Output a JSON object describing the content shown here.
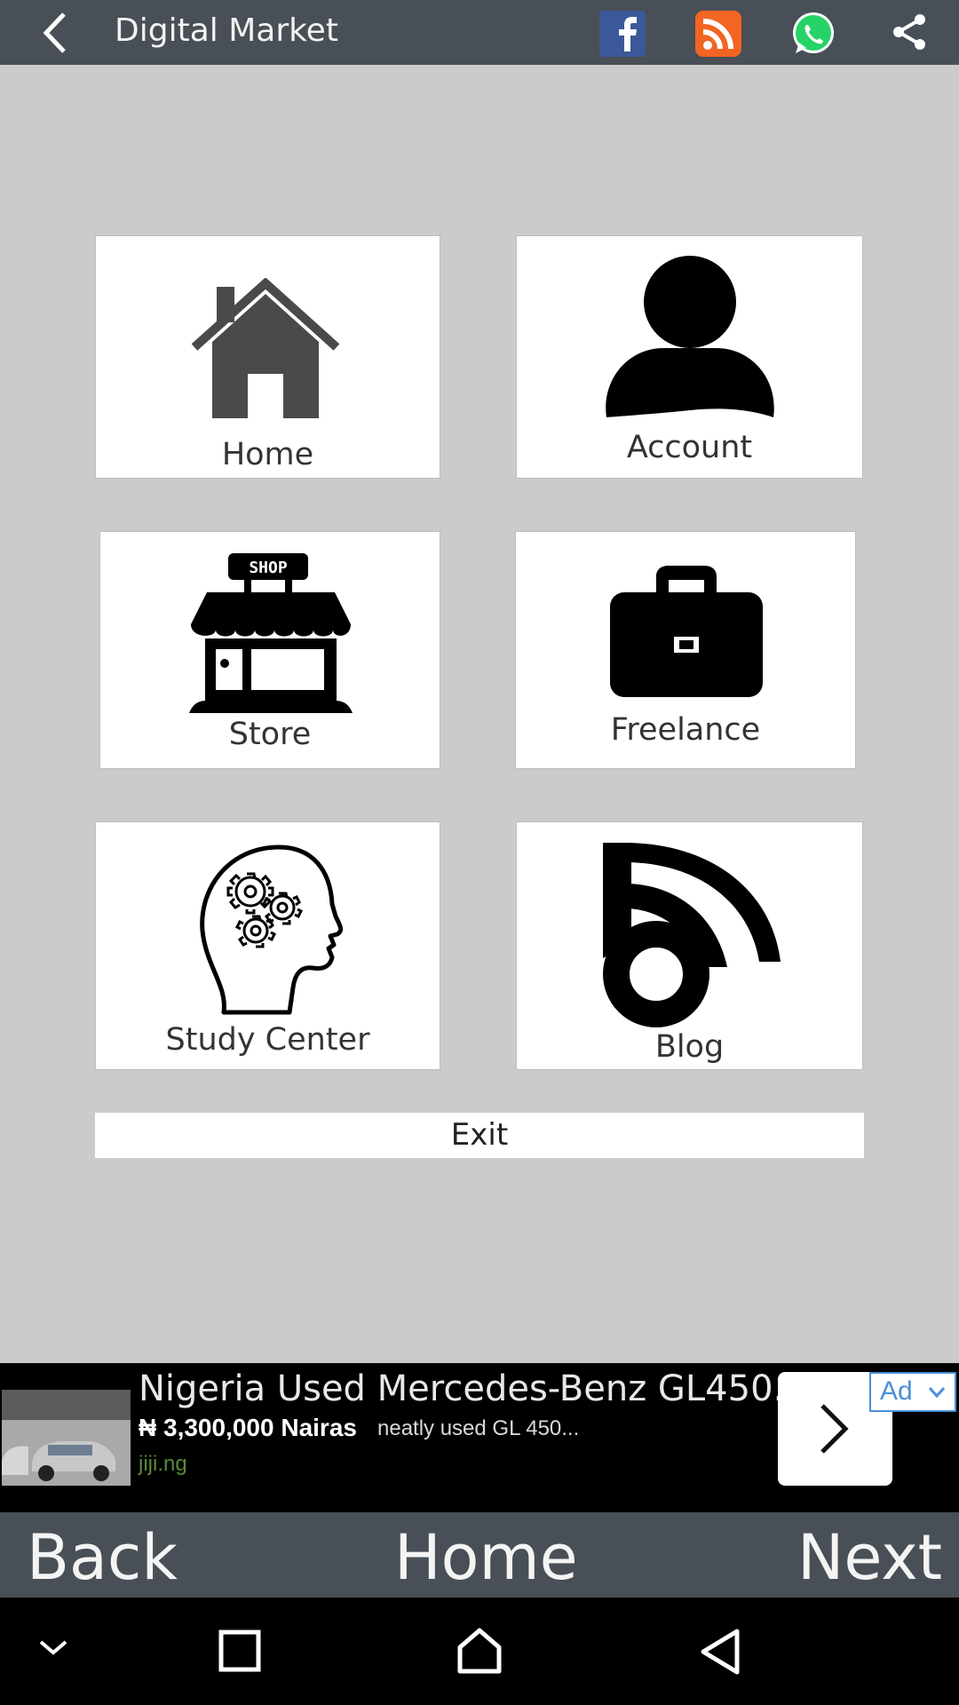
{
  "appbar": {
    "title": "Digital Market",
    "icons": [
      "back-arrow-icon",
      "facebook-icon",
      "rss-icon",
      "whatsapp-icon",
      "share-icon"
    ],
    "colors": {
      "facebook": "#3b5998",
      "rss": "#f26522",
      "whatsapp": "#25d366"
    }
  },
  "tiles": [
    {
      "label": "Home",
      "icon": "house-icon"
    },
    {
      "label": "Account",
      "icon": "user-icon"
    },
    {
      "label": "Store",
      "icon": "shop-icon"
    },
    {
      "label": "Freelance",
      "icon": "briefcase-icon"
    },
    {
      "label": "Study Center",
      "icon": "head-gears-icon"
    },
    {
      "label": "Blog",
      "icon": "blog-icon"
    }
  ],
  "exit_label": "Exit",
  "ad": {
    "headline": "Nigeria Used Mercedes-Benz GL450...",
    "price": "₦ 3,300,000 Nairas",
    "description": "neatly used GL 450...",
    "domain": "jiji.ng",
    "badge": "Ad"
  },
  "bottom_nav": {
    "back": "Back",
    "home": "Home",
    "next": "Next"
  }
}
